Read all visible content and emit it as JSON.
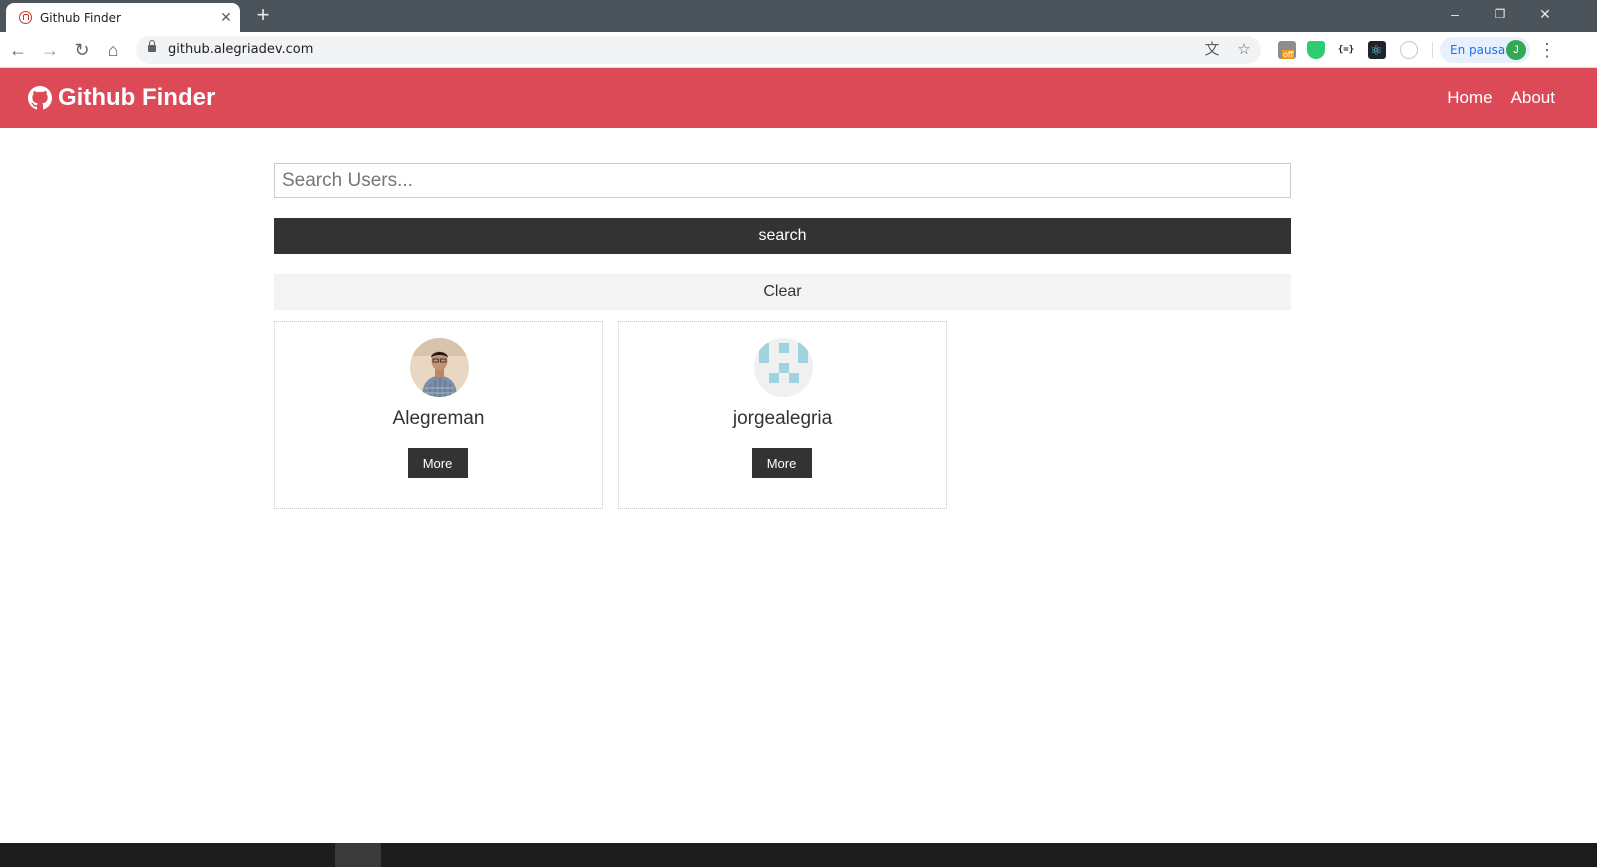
{
  "browser": {
    "tab_title": "Github Finder",
    "url": "github.alegriadev.com",
    "profile_status": "En pausa",
    "profile_initial": "J",
    "ext_off_label": "off",
    "ext_json_label": "{=}"
  },
  "app": {
    "brand": "Github Finder",
    "nav": [
      {
        "label": "Home"
      },
      {
        "label": "About"
      }
    ]
  },
  "search": {
    "placeholder": "Search Users...",
    "value": "",
    "submit_label": "search",
    "clear_label": "Clear"
  },
  "users": [
    {
      "login": "Alegreman",
      "more_label": "More",
      "avatar": "photo-avatar"
    },
    {
      "login": "jorgealegria",
      "more_label": "More",
      "avatar": "identicon-avatar"
    }
  ],
  "colors": {
    "navbar": "#dc4a57",
    "dark_button": "#333333",
    "light_button": "#f4f4f4",
    "identicon": "#9ed4e0"
  }
}
